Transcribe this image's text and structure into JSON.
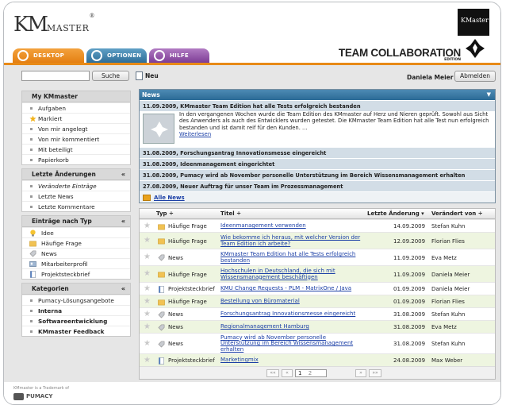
{
  "header": {
    "logo_km": "KM",
    "logo_master": "MASTER",
    "logo_reg": "®",
    "brand_cube_label": "KMaster",
    "brand_title": "TEAM COLLABORATION",
    "brand_edition": "EDITION"
  },
  "tabs": [
    {
      "label": "DESKTOP"
    },
    {
      "label": "OPTIONEN"
    },
    {
      "label": "HILFE"
    }
  ],
  "toolbar": {
    "search_value": "",
    "search_label": "Suche",
    "new_label": "Neu",
    "user_name": "Daniela Meier",
    "logout_label": "Abmelden"
  },
  "sidebar": {
    "my": {
      "title": "My KMmaster",
      "items": [
        "Aufgaben",
        "Markiert",
        "Von mir angelegt",
        "Von mir kommentiert",
        "Mit beteiligt",
        "Papierkorb"
      ]
    },
    "changes": {
      "title": "Letzte Änderungen",
      "items": [
        "Veränderte Einträge",
        "Letzte News",
        "Letzte Kommentare"
      ]
    },
    "types": {
      "title": "Einträge nach Typ",
      "items": [
        "Idee",
        "Häufige Frage",
        "News",
        "Mitarbeiterprofil",
        "Projektsteckbrief"
      ]
    },
    "categories": {
      "title": "Kategorien",
      "items": [
        "Pumacy-Lösungsangebote",
        "Interna",
        "Softwareentwicklung",
        "KMmaster Feedback"
      ]
    },
    "collapse_glyph": "«"
  },
  "news": {
    "title": "News",
    "first_headline": "11.09.2009, KMmaster Team Edition hat alle Tests erfolgreich bestanden",
    "first_body": "In den vergangenen Wochen wurde die Team Edition des KMmaster auf Herz und Nieren geprüft. Sowohl aus Sicht des Anwenders als auch des Entwicklers wurden getestet. Die KMmaster Team Edition hat alle Test nun erfolgreich bestanden und ist damit reif für den Kunden. ...",
    "first_more": "Weiterlesen",
    "headlines": [
      "31.08.2009, Forschungsantrag Innovationsmesse eingereicht",
      "31.08.2009, Ideenmanagement eingerichtet",
      "31.08.2009, Pumacy wird ab November personelle Unterstützung im Bereich Wissensmanagement erhalten",
      "27.08.2009, Neuer Auftrag für unser Team im Prozessmanagement"
    ],
    "all_news": "Alle News"
  },
  "table": {
    "headers": {
      "type": "Typ ÷",
      "title": "Titel ÷",
      "date": "Letzte Änderung ▾",
      "changed_by": "Verändert von ÷"
    },
    "rows": [
      {
        "type": "Häufige Frage",
        "title": "Ideenmanagement verwenden",
        "date": "14.09.2009",
        "by": "Stefan Kuhn"
      },
      {
        "type": "Häufige Frage",
        "title": "Wie bekomme ich heraus, mit welcher Version der Team Edition ich arbeite?",
        "date": "12.09.2009",
        "by": "Florian Flies"
      },
      {
        "type": "News",
        "title": "KMmaster Team Edition hat alle Tests erfolgreich bestanden",
        "date": "11.09.2009",
        "by": "Eva Metz"
      },
      {
        "type": "Häufige Frage",
        "title": "Hochschulen in Deutschland, die sich mit Wissensmanagement beschäftigen",
        "date": "11.09.2009",
        "by": "Daniela Meier"
      },
      {
        "type": "Projektsteckbrief",
        "title": "KMU Change Requests - PLM - MatrixOne / Java",
        "date": "01.09.2009",
        "by": "Daniela Meier"
      },
      {
        "type": "Häufige Frage",
        "title": "Bestellung von Büromaterial",
        "date": "01.09.2009",
        "by": "Florian Flies"
      },
      {
        "type": "News",
        "title": "Forschungsantrag Innovationsmesse eingereicht",
        "date": "31.08.2009",
        "by": "Stefan Kuhn"
      },
      {
        "type": "News",
        "title": "Regionalmanagement Hamburg",
        "date": "31.08.2009",
        "by": "Eva Metz"
      },
      {
        "type": "News",
        "title": "Pumacy wird ab November personelle Unterstützung im Bereich Wissensmanagement erhalten",
        "date": "31.08.2009",
        "by": "Stefan Kuhn"
      },
      {
        "type": "Projektsteckbrief",
        "title": "Marketingmix",
        "date": "24.08.2009",
        "by": "Max Weber"
      }
    ],
    "pager": {
      "first": "««",
      "prev": "«",
      "page": "1",
      "of": "2",
      "next": "»",
      "last": "»»"
    }
  },
  "footer": {
    "trademark": "KMmaster is a Trademark of",
    "company": "PUMACY"
  },
  "colors": {
    "accent_orange": "#e88a17",
    "news_blue": "#2b6a96",
    "link_blue": "#1b3fa6"
  }
}
